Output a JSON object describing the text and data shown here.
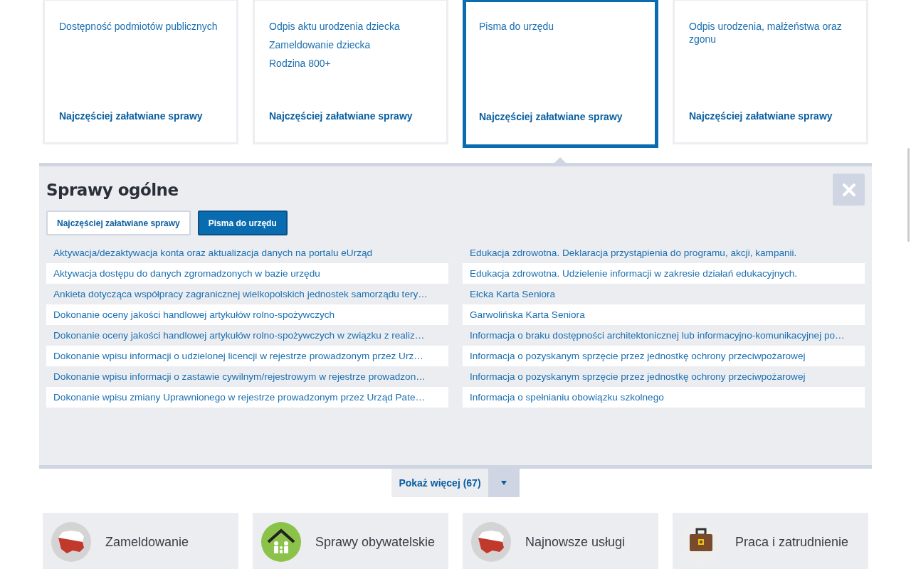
{
  "cards": [
    {
      "links": [
        "Dostępność podmiotów publicznych"
      ],
      "footer": "Najczęściej załatwiane sprawy",
      "selected": false
    },
    {
      "links": [
        "Odpis aktu urodzenia dziecka",
        "Zameldowanie dziecka",
        "Rodzina 800+"
      ],
      "footer": "Najczęściej załatwiane sprawy",
      "selected": false
    },
    {
      "links": [
        "Pisma do urzędu"
      ],
      "footer": "Najczęściej załatwiane sprawy",
      "selected": true
    },
    {
      "links": [
        "Odpis urodzenia, małżeństwa oraz zgonu"
      ],
      "footer": "Najczęściej załatwiane sprawy",
      "selected": false
    }
  ],
  "panel": {
    "title": "Sprawy ogólne",
    "tabs": [
      {
        "label": "Najczęściej załatwiane sprawy",
        "selected": false
      },
      {
        "label": "Pisma do urzędu",
        "selected": true
      }
    ],
    "columns": [
      [
        "Aktywacja/dezaktywacja konta oraz aktualizacja danych na portalu eUrząd",
        "Aktywacja dostępu do danych zgromadzonych w bazie urzędu",
        "Ankieta dotycząca współpracy zagranicznej wielkopolskich jednostek samorządu tery…",
        "Dokonanie oceny jakości handlowej artykułów rolno-spożywczych",
        "Dokonanie oceny jakości handlowej artykułów rolno-spożywczych w związku z realiz…",
        "Dokonanie wpisu informacji o udzielonej licencji w rejestrze prowadzonym przez Urz…",
        "Dokonanie wpisu informacji o zastawie cywilnym/rejestrowym w rejestrze prowadzon…",
        "Dokonanie wpisu zmiany Uprawnionego w rejestrze prowadzonym przez Urząd Pate…"
      ],
      [
        "Edukacja zdrowotna. Deklaracja przystąpienia do programu, akcji, kampanii.",
        "Edukacja zdrowotna. Udzielenie informacji w zakresie działań edukacyjnych.",
        "Ełcka Karta Seniora",
        "Garwolińska Karta Seniora",
        "Informacja o braku dostępności architektonicznej lub informacyjno-komunikacyjnej po…",
        "Informacja o pozyskanym sprzęcie przez jednostkę ochrony przeciwpożarowej",
        "Informacja o pozyskanym sprzęcie przez jednostkę ochrony przeciwpożarowej",
        "Informacja o spełnianiu obowiązku szkolnego"
      ]
    ]
  },
  "show_more": {
    "label": "Pokaż więcej (67)"
  },
  "categories": [
    {
      "label": "Zameldowanie",
      "kind": "map"
    },
    {
      "label": "Sprawy obywatelskie",
      "kind": "family"
    },
    {
      "label": "Najnowsze usługi",
      "kind": "map"
    },
    {
      "label": "Praca i zatrudnienie",
      "kind": "briefcase"
    }
  ]
}
